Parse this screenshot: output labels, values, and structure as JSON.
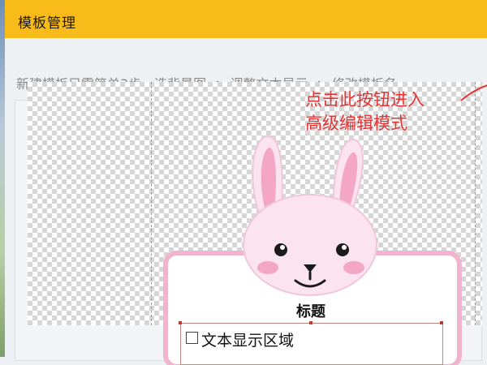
{
  "window": {
    "title": "模板管理"
  },
  "instructions": "新建模板只需简单3步，选背景图 -> 调整文本显示 -> 修改模板名",
  "annotation": {
    "line1": "点击此按钮进入",
    "line2": "高级编辑模式"
  },
  "template": {
    "title_label": "标题",
    "text_area_label": "文本显示区域"
  },
  "colors": {
    "titlebar": "#f8bb19",
    "annotation": "#e63434",
    "card_border": "#f2b3cd"
  },
  "icons": {
    "checkbox": "checkbox-icon",
    "arrow": "arrow-icon"
  }
}
